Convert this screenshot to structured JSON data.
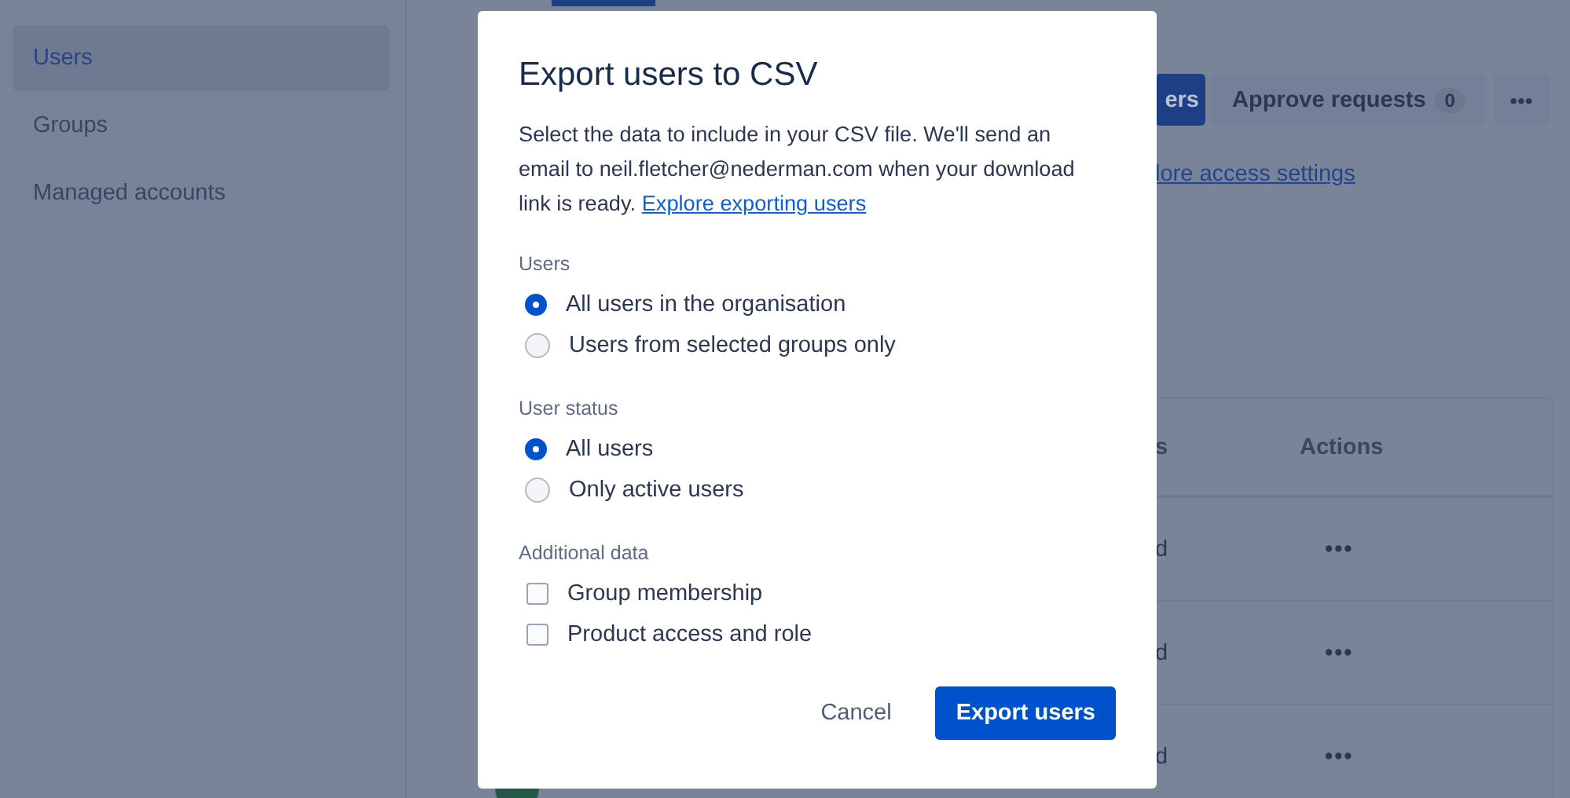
{
  "sidebar": {
    "items": [
      {
        "label": "Users",
        "selected": true
      },
      {
        "label": "Groups",
        "selected": false
      },
      {
        "label": "Managed accounts",
        "selected": false
      }
    ]
  },
  "toolbar": {
    "primary_button": "ers",
    "approve_button": {
      "label": "Approve requests",
      "badge": "0"
    },
    "more_button": "•••"
  },
  "access_link": "lore access settings",
  "table": {
    "columns": [
      "s",
      "Actions"
    ],
    "rows": [
      {
        "column_1": "d",
        "actions": "•••"
      },
      {
        "column_1": "d",
        "actions": "•••"
      },
      {
        "column_1": "d",
        "actions": "•••"
      }
    ]
  },
  "dialog": {
    "title": "Export users to CSV",
    "body": "Select the data to include in your CSV file. We'll send an email to neil.fletcher@nederman.com when your download link is ready.",
    "body_link": "Explore exporting users",
    "sections": [
      {
        "label": "Users",
        "kind": "radio",
        "options": [
          {
            "label": "All users in the organisation",
            "selected": true
          },
          {
            "label": "Users from selected groups only",
            "selected": false
          }
        ]
      },
      {
        "label": "User status",
        "kind": "radio",
        "options": [
          {
            "label": "All users",
            "selected": true
          },
          {
            "label": "Only active users",
            "selected": false
          }
        ]
      },
      {
        "label": "Additional data",
        "kind": "checkbox",
        "options": [
          {
            "label": "Group membership",
            "checked": false
          },
          {
            "label": "Product access and role",
            "checked": false
          }
        ]
      }
    ],
    "cancel_button": "Cancel",
    "submit_button": "Export users"
  }
}
